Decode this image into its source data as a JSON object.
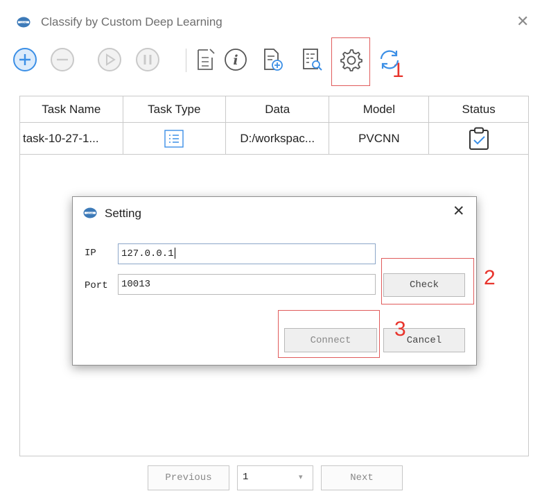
{
  "window": {
    "title": "Classify by Custom Deep Learning",
    "close_glyph": "✕"
  },
  "toolbar": {
    "buttons": [
      {
        "name": "add-task",
        "icon": "plus-circle-icon"
      },
      {
        "name": "remove-task",
        "icon": "minus-circle-icon"
      },
      {
        "name": "start-task",
        "icon": "play-circle-icon"
      },
      {
        "name": "pause-task",
        "icon": "pause-circle-icon"
      },
      {
        "name": "edit-task",
        "icon": "edit-document-icon"
      },
      {
        "name": "info",
        "icon": "info-icon"
      },
      {
        "name": "new-file",
        "icon": "add-file-icon"
      },
      {
        "name": "inspect",
        "icon": "checklist-search-icon"
      },
      {
        "name": "settings",
        "icon": "gear-icon"
      },
      {
        "name": "refresh",
        "icon": "refresh-icon"
      }
    ],
    "accent_blue": "#3b8fe6",
    "disabled_gray": "#c9c9c9"
  },
  "annotations": {
    "one": "1",
    "two": "2",
    "three": "3",
    "color": "#e8342c"
  },
  "table": {
    "columns": [
      "Task Name",
      "Task Type",
      "Data",
      "Model",
      "Status"
    ],
    "rows": [
      {
        "task_name": "task-10-27-1...",
        "task_type_icon": "list-icon",
        "data": "D:/workspac...",
        "model": "PVCNN",
        "status_icon": "clipboard-check-icon"
      }
    ]
  },
  "dialog": {
    "title": "Setting",
    "close_glyph": "✕",
    "ip_label": "IP",
    "ip_value": "127.0.0.1",
    "port_label": "Port",
    "port_value": "10013",
    "check_label": "Check",
    "connect_label": "Connect",
    "cancel_label": "Cancel"
  },
  "pagination": {
    "previous_label": "Previous",
    "page_value": "1",
    "next_label": "Next"
  }
}
